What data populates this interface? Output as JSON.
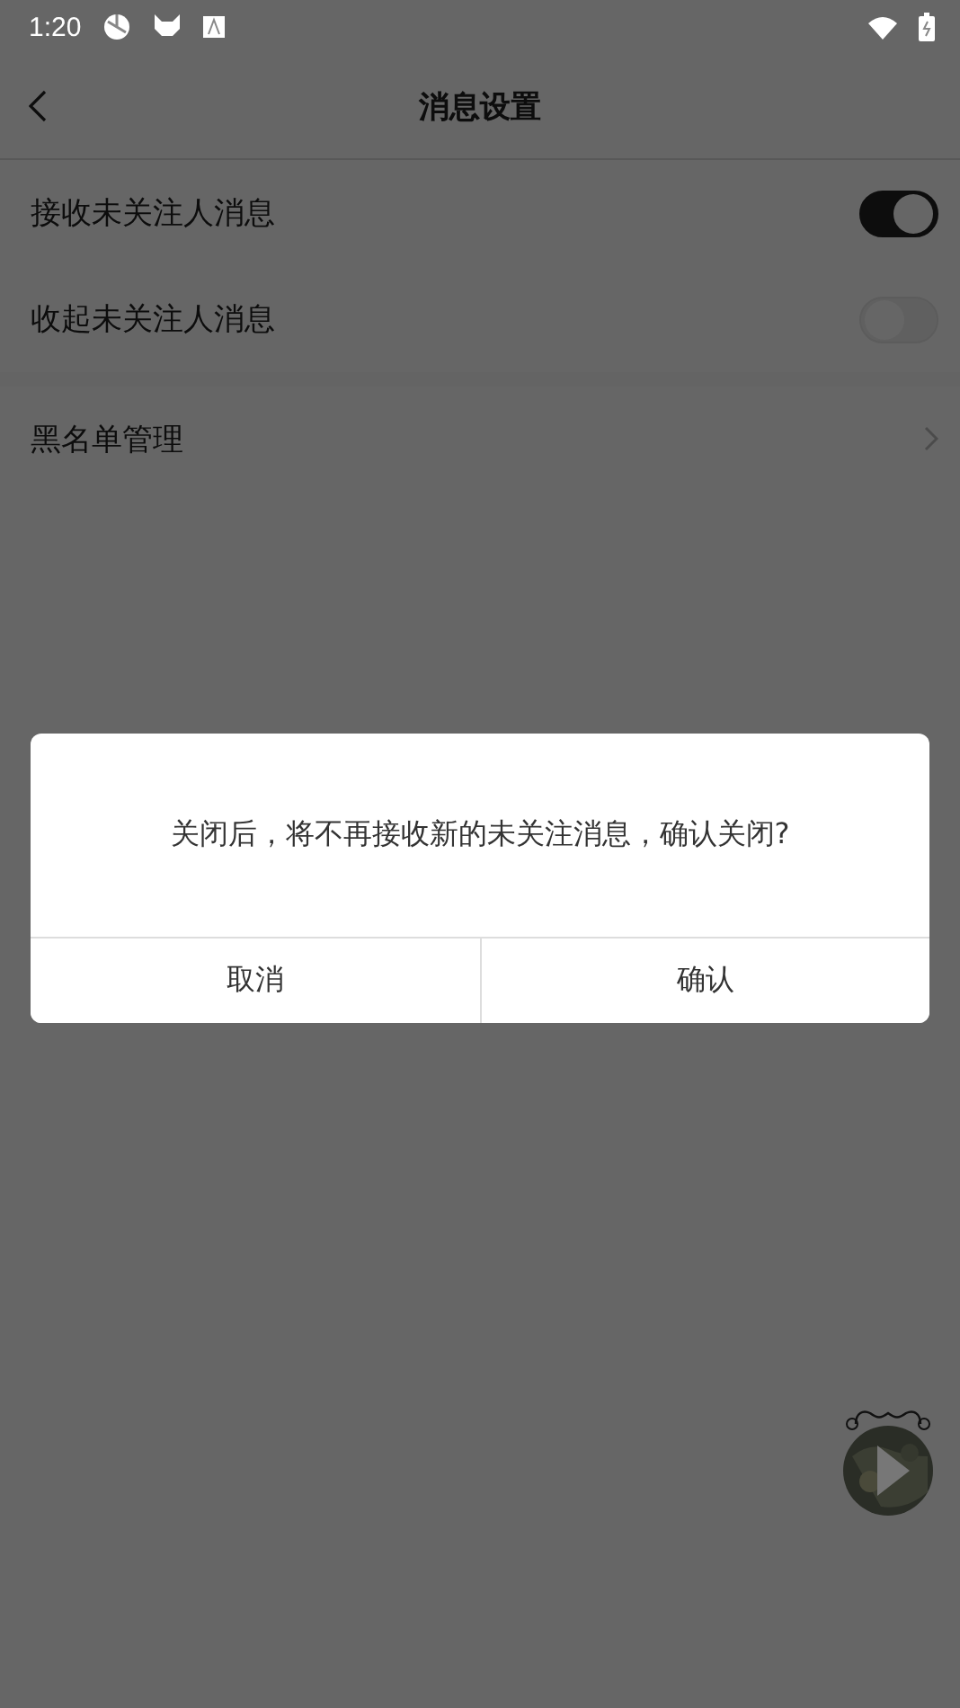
{
  "status_bar": {
    "time": "1:20"
  },
  "header": {
    "title": "消息设置"
  },
  "settings": [
    {
      "kind": "toggle",
      "label": "接收未关注人消息",
      "on": true
    },
    {
      "kind": "toggle",
      "label": "收起未关注人消息",
      "on": false
    },
    {
      "kind": "link",
      "label": "黑名单管理"
    }
  ],
  "dialog": {
    "message": "关闭后，将不再接收新的未关注消息，确认关闭?",
    "buttons": [
      "取消",
      "确认"
    ]
  }
}
